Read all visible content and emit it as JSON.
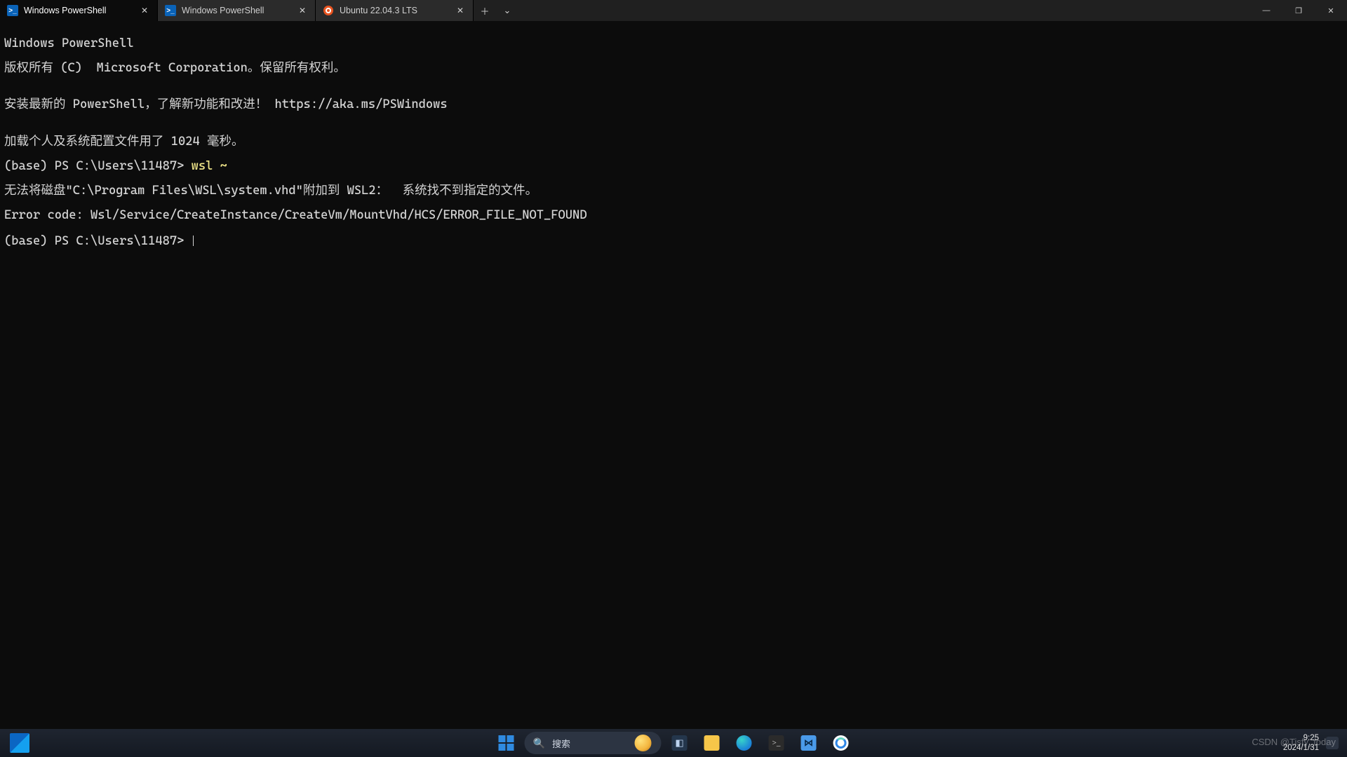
{
  "tabs": [
    {
      "label": "Windows PowerShell",
      "icon": "powershell",
      "active": true
    },
    {
      "label": "Windows PowerShell",
      "icon": "powershell",
      "active": false
    },
    {
      "label": "Ubuntu 22.04.3 LTS",
      "icon": "ubuntu",
      "active": false
    }
  ],
  "window_controls": {
    "minimize": "—",
    "maximize": "❐",
    "close": "✕"
  },
  "tab_controls": {
    "new_tab": "＋",
    "menu": "⌄",
    "close": "✕"
  },
  "terminal": {
    "lines": [
      "Windows PowerShell",
      "版权所有 (C)  Microsoft Corporation。保留所有权利。",
      "",
      "安装最新的 PowerShell，了解新功能和改进！ https://aka.ms/PSWindows",
      "",
      "加载个人及系统配置文件用了 1024 毫秒。"
    ],
    "prompt1": "(base) PS C:\\Users\\11487> ",
    "command1": "wsl ~",
    "err_lines": [
      "无法将磁盘\"C:\\Program Files\\WSL\\system.vhd\"附加到 WSL2：  系统找不到指定的文件。",
      "Error code: Wsl/Service/CreateInstance/CreateVm/MountVhd/HCS/ERROR_FILE_NOT_FOUND"
    ],
    "prompt2": "(base) PS C:\\Users\\11487> "
  },
  "taskbar": {
    "search_placeholder": "搜索",
    "icons": {
      "start": "start",
      "taskview": "taskview",
      "explorer": "explorer",
      "edge": "edge",
      "terminal": ">_",
      "code": "⋈",
      "chat": "chat"
    },
    "clock_time": "9:25",
    "clock_date": "2024/1/31"
  },
  "watermark": "CSDN @Tisfy_today"
}
